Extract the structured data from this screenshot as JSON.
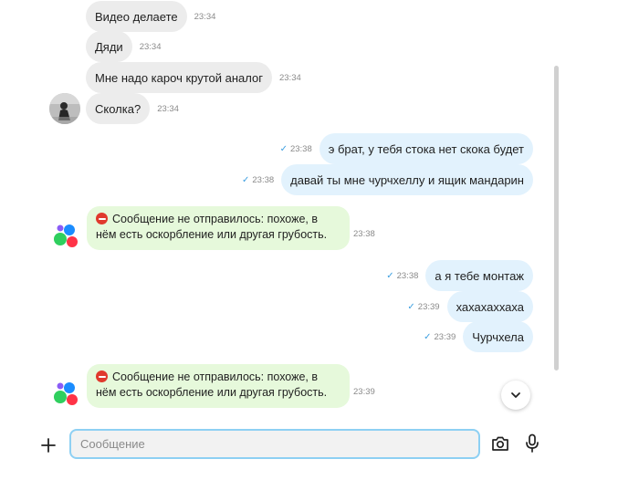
{
  "composer": {
    "placeholder": "Сообщение"
  },
  "messages": [
    {
      "text": "Видео делаете",
      "time": "23:34"
    },
    {
      "text": "Дяди",
      "time": "23:34"
    },
    {
      "text": "Мне надо кароч крутой аналог",
      "time": "23:34"
    },
    {
      "text": "Сколка?",
      "time": "23:34"
    },
    {
      "text": "э брат, у тебя стока нет скока будет",
      "time": "23:38"
    },
    {
      "text": "давай ты мне чурчхеллу и ящик мандарин",
      "time": "23:38"
    },
    {
      "text": "Сообщение не отправилось: похоже, в нём есть оскорбление или другая грубость.",
      "time": "23:38"
    },
    {
      "text": "а я тебе монтаж",
      "time": "23:38"
    },
    {
      "text": "хахахаххаха",
      "time": "23:39"
    },
    {
      "text": "Чурчхела",
      "time": "23:39"
    },
    {
      "text": "Сообщение не отправилось: похоже, в нём есть оскорбление или другая грубость.",
      "time": "23:39"
    }
  ],
  "colors": {
    "incoming_bubble": "#ececec",
    "outgoing_bubble": "#e2f2fd",
    "system_bubble": "#e6f9db",
    "input_border": "#8ed0f3",
    "read_tick": "#3d9fe0"
  }
}
